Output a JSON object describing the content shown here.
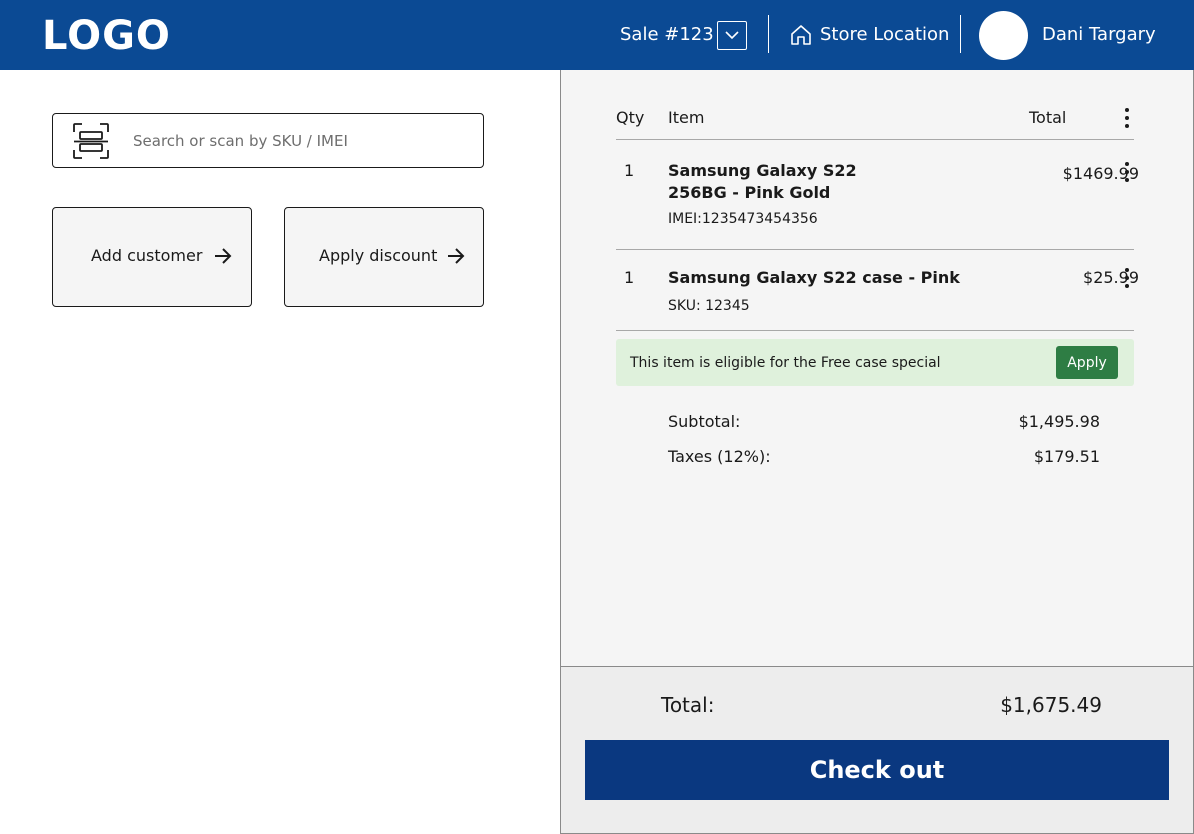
{
  "header": {
    "logo": "LOGO",
    "sale_label": "Sale #123",
    "store_label": "Store Location",
    "user_name": "Dani Targary"
  },
  "search": {
    "placeholder": "Search or scan by SKU / IMEI",
    "value": ""
  },
  "actions": {
    "add_customer": "Add customer",
    "apply_discount": "Apply discount"
  },
  "cart": {
    "columns": {
      "qty": "Qty",
      "item": "Item",
      "total": "Total"
    },
    "items": [
      {
        "qty": "1",
        "name": "Samsung Galaxy S22 256BG - Pink Gold",
        "sub": "IMEI:1235473454356",
        "total": "$1469.99"
      },
      {
        "qty": "1",
        "name": "Samsung Galaxy S22 case - Pink",
        "sub": "SKU: 12345",
        "total": "$25.99"
      }
    ],
    "promo": {
      "text": "This item is eligible for the Free case special",
      "button": "Apply"
    },
    "subtotal_label": "Subtotal:",
    "subtotal_value": "$1,495.98",
    "taxes_label": "Taxes (12%):",
    "taxes_value": "$179.51"
  },
  "footer": {
    "total_label": "Total:",
    "total_value": "$1,675.49",
    "checkout": "Check out"
  },
  "colors": {
    "header_bg": "#0b4a94",
    "checkout_bg": "#0a3880",
    "promo_bg": "#dff1dc",
    "promo_button": "#2e7d44",
    "panel_bg": "#f5f5f5"
  }
}
